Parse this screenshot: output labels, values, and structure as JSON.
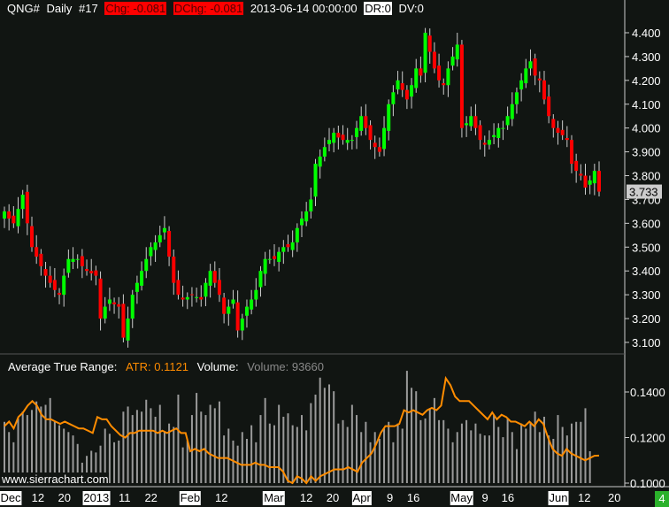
{
  "header": {
    "symbol": "QNG#",
    "period": "Daily",
    "num": "#17",
    "chg": "Chg: -0.081",
    "dchg": "DChg: -0.081",
    "datetime": "2013-06-14 00:00:00",
    "dr": "DR:0",
    "dv": "DV:0"
  },
  "indicator": {
    "atr_title": "Average True Range:",
    "atr_value": "ATR: 0.1121",
    "vol_title": "Volume:",
    "vol_value": "Volume: 93660"
  },
  "watermark": "www.sierrachart.com",
  "page_label": "4",
  "colors": {
    "up": "#00ff00",
    "down": "#ff0000",
    "atr": "#ff8c00",
    "volume": "#9a9a9a"
  },
  "chart_data": [
    {
      "type": "candlestick",
      "title": "QNG# Daily",
      "ylim": [
        3.05,
        4.45
      ],
      "yticks": [
        "4.400",
        "4.300",
        "4.200",
        "4.100",
        "4.000",
        "3.900",
        "3.800",
        "3.700",
        "3.600",
        "3.500",
        "3.400",
        "3.300",
        "3.200",
        "3.100"
      ],
      "last_price": "3.733",
      "close": [
        3.65,
        3.62,
        3.6,
        3.66,
        3.72,
        3.6,
        3.5,
        3.46,
        3.42,
        3.38,
        3.35,
        3.32,
        3.3,
        3.38,
        3.45,
        3.45,
        3.45,
        3.42,
        3.4,
        3.39,
        3.38,
        3.2,
        3.25,
        3.28,
        3.26,
        3.25,
        3.12,
        3.2,
        3.3,
        3.35,
        3.4,
        3.45,
        3.5,
        3.52,
        3.55,
        3.58,
        3.46,
        3.35,
        3.3,
        3.28,
        3.29,
        3.3,
        3.29,
        3.28,
        3.35,
        3.4,
        3.35,
        3.3,
        3.22,
        3.25,
        3.28,
        3.15,
        3.2,
        3.25,
        3.28,
        3.32,
        3.4,
        3.45,
        3.45,
        3.45,
        3.48,
        3.5,
        3.5,
        3.52,
        3.58,
        3.62,
        3.65,
        3.7,
        3.85,
        3.88,
        3.92,
        3.95,
        3.98,
        3.96,
        3.95,
        3.95,
        3.95,
        4.0,
        4.05,
        4.0,
        3.95,
        3.92,
        3.9,
        4.0,
        4.1,
        4.15,
        4.2,
        4.16,
        4.12,
        4.18,
        4.25,
        4.22,
        4.4,
        4.32,
        4.25,
        4.2,
        4.18,
        4.25,
        4.3,
        4.35,
        4.0,
        4.02,
        4.05,
        4.0,
        3.95,
        3.93,
        3.95,
        3.97,
        4.0,
        4.0,
        4.05,
        4.1,
        4.15,
        4.2,
        4.25,
        4.28,
        4.22,
        4.2,
        4.12,
        4.05,
        4.0,
        3.98,
        3.97,
        3.95,
        3.85,
        3.82,
        3.8,
        3.75,
        3.78,
        3.82,
        3.733
      ]
    },
    {
      "type": "line+bar",
      "title": "Average True Range / Volume",
      "ylim": [
        0.1,
        0.15
      ],
      "yticks": [
        "0.1400",
        "0.1200",
        "0.1000"
      ],
      "atr": [
        0.125,
        0.127,
        0.124,
        0.129,
        0.131,
        0.134,
        0.136,
        0.134,
        0.13,
        0.128,
        0.128,
        0.127,
        0.126,
        0.127,
        0.126,
        0.125,
        0.124,
        0.124,
        0.123,
        0.122,
        0.129,
        0.128,
        0.128,
        0.125,
        0.123,
        0.121,
        0.12,
        0.122,
        0.122,
        0.123,
        0.123,
        0.123,
        0.123,
        0.122,
        0.123,
        0.122,
        0.123,
        0.124,
        0.122,
        0.122,
        0.114,
        0.115,
        0.114,
        0.115,
        0.113,
        0.112,
        0.111,
        0.111,
        0.111,
        0.11,
        0.109,
        0.108,
        0.108,
        0.108,
        0.109,
        0.108,
        0.108,
        0.107,
        0.107,
        0.107,
        0.105,
        0.101,
        0.1,
        0.103,
        0.102,
        0.1,
        0.103,
        0.101,
        0.103,
        0.104,
        0.105,
        0.106,
        0.106,
        0.106,
        0.107,
        0.106,
        0.105,
        0.109,
        0.111,
        0.113,
        0.117,
        0.122,
        0.125,
        0.125,
        0.125,
        0.126,
        0.132,
        0.131,
        0.132,
        0.131,
        0.13,
        0.132,
        0.133,
        0.132,
        0.134,
        0.146,
        0.143,
        0.138,
        0.136,
        0.136,
        0.136,
        0.134,
        0.132,
        0.13,
        0.128,
        0.131,
        0.128,
        0.13,
        0.129,
        0.127,
        0.127,
        0.126,
        0.125,
        0.127,
        0.125,
        0.128,
        0.126,
        0.12,
        0.115,
        0.113,
        0.112,
        0.115,
        0.113,
        0.112,
        0.111,
        0.11,
        0.111,
        0.112,
        0.1121
      ],
      "volume": [
        180000,
        150000,
        120000,
        190000,
        210000,
        200000,
        215000,
        240000,
        225000,
        230000,
        250000,
        180000,
        170000,
        160000,
        150000,
        140000,
        115000,
        60000,
        80000,
        95000,
        90000,
        110000,
        160000,
        145000,
        120000,
        125000,
        210000,
        225000,
        200000,
        215000,
        210000,
        245000,
        220000,
        195000,
        230000,
        150000,
        175000,
        165000,
        260000,
        105000,
        125000,
        200000,
        265000,
        210000,
        200000,
        230000,
        220000,
        240000,
        140000,
        160000,
        125000,
        110000,
        150000,
        130000,
        170000,
        120000,
        200000,
        250000,
        175000,
        170000,
        230000,
        195000,
        205000,
        170000,
        165000,
        200000,
        155000,
        235000,
        260000,
        310000,
        280000,
        290000,
        270000,
        175000,
        185000,
        165000,
        230000,
        200000,
        150000,
        180000,
        120000,
        150000,
        130000,
        160000,
        180000,
        120000,
        175000,
        160000,
        330000,
        280000,
        270000,
        185000,
        190000,
        220000,
        250000,
        185000,
        185000,
        160000,
        120000,
        150000,
        175000,
        185000,
        155000,
        175000,
        145000,
        140000,
        140000,
        200000,
        165000,
        135000,
        190000,
        150000,
        100000,
        175000,
        160000,
        180000,
        210000,
        150000,
        195000,
        140000,
        130000,
        200000,
        165000,
        140000,
        175000,
        180000,
        180000,
        220000,
        93660
      ]
    },
    {
      "type": "axis",
      "x_labels": [
        {
          "t": "Dec",
          "box": true,
          "pos": 0.01
        },
        {
          "t": "12",
          "pos": 0.063
        },
        {
          "t": "20",
          "pos": 0.107
        },
        {
          "t": "2013",
          "box": true,
          "pos": 0.16
        },
        {
          "t": "11",
          "pos": 0.207
        },
        {
          "t": "22",
          "pos": 0.251
        },
        {
          "t": "Feb",
          "box": true,
          "pos": 0.316
        },
        {
          "t": "12",
          "pos": 0.368
        },
        {
          "t": "Mar",
          "box": true,
          "pos": 0.455
        },
        {
          "t": "12",
          "pos": 0.509
        },
        {
          "t": "20",
          "pos": 0.553
        },
        {
          "t": "Apr",
          "box": true,
          "pos": 0.601
        },
        {
          "t": "9",
          "pos": 0.648
        },
        {
          "t": "16",
          "pos": 0.687
        },
        {
          "t": "May",
          "box": true,
          "pos": 0.767
        },
        {
          "t": "9",
          "pos": 0.806
        },
        {
          "t": "16",
          "pos": 0.844
        },
        {
          "t": "Jun",
          "box": true,
          "pos": 0.928
        },
        {
          "t": "12",
          "pos": 0.971
        },
        {
          "t": "20",
          "pos": 1.021
        }
      ]
    }
  ]
}
